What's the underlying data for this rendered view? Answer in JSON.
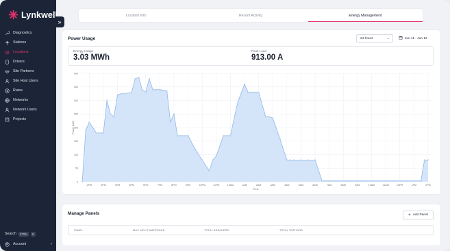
{
  "app": {
    "name": "Lynkwell"
  },
  "sidebar": {
    "items": [
      {
        "label": "Diagnostics",
        "icon": "wrench-icon",
        "active": false
      },
      {
        "label": "Stations",
        "icon": "plug-icon",
        "active": false
      },
      {
        "label": "Locations",
        "icon": "location-icon",
        "active": true
      },
      {
        "label": "Drivers",
        "icon": "phone-icon",
        "active": false
      },
      {
        "label": "Site Partners",
        "icon": "handshake-icon",
        "active": false
      },
      {
        "label": "Site Host Users",
        "icon": "user-icon",
        "active": false
      },
      {
        "label": "Rates",
        "icon": "dollar-icon",
        "active": false
      },
      {
        "label": "Networks",
        "icon": "globe-icon",
        "active": false
      },
      {
        "label": "Network Users",
        "icon": "user-icon",
        "active": false
      },
      {
        "label": "Projects",
        "icon": "building-icon",
        "active": false
      }
    ],
    "search": {
      "label": "Search",
      "kbd1": "CTRL",
      "kbd2": "K"
    },
    "account": {
      "label": "Account"
    },
    "accent": "#e0316b",
    "background": "#1b2537"
  },
  "tabs": [
    {
      "label": "Location Info",
      "active": false
    },
    {
      "label": "Recent Activity",
      "active": false
    },
    {
      "label": "Energy Management",
      "active": true
    }
  ],
  "power_usage": {
    "title": "Power Usage",
    "range_select": "24 hours",
    "date_range": "Jun 11 - Jun 12",
    "energy_label": "Energy Usage",
    "energy_value": "3.03 MWh",
    "peak_label": "Peak Load",
    "peak_value": "913.00 A"
  },
  "chart_data": {
    "type": "area",
    "title": "",
    "xlabel": "Time",
    "ylabel": "Power (kW)",
    "ylim": [
      0,
      400
    ],
    "yticks": [
      0,
      50,
      100,
      150,
      200,
      250,
      300,
      350,
      400
    ],
    "xticks": [
      "2PM",
      "3PM",
      "4PM",
      "5PM",
      "6PM",
      "7PM",
      "8PM",
      "9PM",
      "10PM",
      "11PM",
      "12AM",
      "1AM",
      "2AM",
      "3AM",
      "4AM",
      "5AM",
      "6AM",
      "7AM",
      "8AM",
      "9AM",
      "10AM",
      "11AM",
      "12PM",
      "1PM",
      "2PM"
    ],
    "x_start_hour": 13.4,
    "x_end_hour": 38.2,
    "hours": [
      13.5,
      13.75,
      14.0,
      14.5,
      15.0,
      15.25,
      15.5,
      15.75,
      16.0,
      16.25,
      16.5,
      17.0,
      17.25,
      17.5,
      17.75,
      18.0,
      18.25,
      18.5,
      18.75,
      19.0,
      19.5,
      19.75,
      20.0,
      20.25,
      20.5,
      21.0,
      21.5,
      22.0,
      22.5,
      22.75,
      23.0,
      23.5,
      24.0,
      24.5,
      25.0,
      25.25,
      25.5,
      26.0,
      26.5,
      26.75,
      27.0,
      27.5,
      28.0,
      28.25,
      28.5,
      29.0,
      29.5,
      30.0,
      30.5,
      31.0,
      31.25,
      31.5,
      32.0,
      32.5,
      33.0,
      33.5,
      34.0,
      34.5,
      35.0,
      35.5,
      36.0,
      36.5,
      37.0,
      37.5,
      37.75,
      38.0
    ],
    "values": [
      0,
      190,
      220,
      180,
      180,
      300,
      250,
      240,
      320,
      325,
      325,
      330,
      380,
      385,
      340,
      330,
      380,
      340,
      340,
      340,
      335,
      220,
      250,
      170,
      170,
      170,
      120,
      80,
      40,
      80,
      95,
      170,
      170,
      290,
      360,
      330,
      330,
      330,
      240,
      240,
      235,
      160,
      80,
      80,
      80,
      80,
      80,
      80,
      3,
      3,
      3,
      3,
      3,
      3,
      3,
      3,
      3,
      3,
      3,
      3,
      3,
      3,
      3,
      3,
      80,
      80
    ],
    "line_color": "#8fb6e8",
    "fill_color": "#d5e5f9"
  },
  "manage_panels": {
    "title": "Manage Panels",
    "add_label": "Add Panel",
    "columns": [
      "PANEL",
      "MAX INPUT AMPERAGE",
      "TOTAL BREAKERS",
      "TOTAL STATIONS"
    ]
  }
}
